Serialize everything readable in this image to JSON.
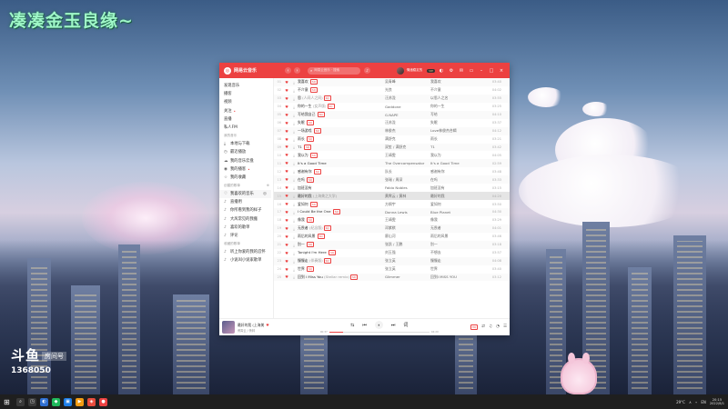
{
  "wallpaper": {
    "title": "凑凑金玉良缘~"
  },
  "douyu": {
    "logo": "斗鱼",
    "room_tag": "房间号",
    "room_number": "1368050"
  },
  "app": {
    "name": "网易云音乐",
    "search_placeholder": "网易云音乐 · 搜索",
    "user_name": "情绪稳定的",
    "vip_badge": "VIP"
  },
  "sidebar": {
    "items": [
      {
        "label": "发现音乐",
        "icon": ""
      },
      {
        "label": "播客",
        "icon": ""
      },
      {
        "label": "视频",
        "icon": ""
      },
      {
        "label": "关注",
        "icon": "",
        "dot": "•"
      },
      {
        "label": "直播",
        "icon": ""
      },
      {
        "label": "私人FM",
        "icon": ""
      }
    ],
    "my_music_title": "我的音乐",
    "my_music_items": [
      {
        "label": "本地与下载",
        "icon": "⤓"
      },
      {
        "label": "最近播放",
        "icon": "◷"
      },
      {
        "label": "我的音乐云盘",
        "icon": "☁"
      },
      {
        "label": "我的播客",
        "icon": "◉",
        "dot": "•"
      },
      {
        "label": "我的收藏",
        "icon": "☆"
      }
    ],
    "created_title": "创建的歌单",
    "created_add": "⊕",
    "created_items": [
      {
        "label": "我喜欢的音乐",
        "icon": "♡",
        "extra": "◎",
        "active": true
      },
      {
        "label": "直播用",
        "icon": "♪"
      },
      {
        "label": "你所看到我的样子",
        "icon": "♪"
      },
      {
        "label": "大风常见的我搬",
        "icon": "♪"
      },
      {
        "label": "喜欢的歌单",
        "icon": "♪"
      },
      {
        "label": "评论",
        "icon": "♪"
      }
    ],
    "fav_title": "收藏的歌单",
    "fav_items": [
      {
        "label": "听上你爱的我的忍怀",
        "icon": "♪"
      },
      {
        "label": "小说叫小说家歌单",
        "icon": "♪"
      }
    ]
  },
  "tracks": [
    {
      "idx": "01",
      "title": "我喜欢",
      "sub": "",
      "tag": "SQ",
      "artist": "吴青峰",
      "album": "我喜欢",
      "time": "03:40"
    },
    {
      "idx": "02",
      "title": "不介意",
      "sub": "",
      "tag": "SQ",
      "artist": "光良",
      "album": "不介意",
      "time": "04:02"
    },
    {
      "idx": "03",
      "title": "思",
      "sub": "(人间人之间)",
      "tag": "SQ",
      "artist": "汪苏泷",
      "album": "以思人之名",
      "time": "03:55"
    },
    {
      "idx": "04",
      "title": "你的一生",
      "sub": "(女声版)",
      "tag": "SQ",
      "artist": "Gaddone",
      "album": "你的一生",
      "time": "03:25"
    },
    {
      "idx": "05",
      "title": "写给我自己",
      "sub": "",
      "tag": "SQ",
      "artist": "G.NAPE",
      "album": "写给",
      "time": "04:10"
    },
    {
      "idx": "06",
      "title": "失眠",
      "sub": "",
      "tag": "SQ",
      "artist": "汪苏泷",
      "album": "失眠",
      "time": "03:37"
    },
    {
      "idx": "07",
      "title": "一场游戏",
      "sub": "",
      "tag": "SQ",
      "artist": "林俊杰",
      "album": "Love林俊杰合辑",
      "time": "04:12"
    },
    {
      "idx": "08",
      "title": "雨长",
      "sub": "",
      "tag": "SQ",
      "artist": "满舒克",
      "album": "雨长",
      "time": "03:21"
    },
    {
      "idx": "09",
      "title": "T1",
      "sub": "",
      "tag": "SQ",
      "artist": "双笙 / 满舒克",
      "album": "T1",
      "time": "03:42"
    },
    {
      "idx": "10",
      "title": "我以为",
      "sub": "",
      "tag": "SQ",
      "artist": "王靖雯",
      "album": "我以为",
      "time": "04:05"
    },
    {
      "idx": "11",
      "title": "It's a Good Time",
      "sub": "",
      "tag": "",
      "artist": "The Overcompensator",
      "album": "It's a Good Time",
      "time": "02:59"
    },
    {
      "idx": "12",
      "title": "感谢有你",
      "sub": "",
      "tag": "SQ",
      "artist": "队长",
      "album": "感谢有你",
      "time": "03:48"
    },
    {
      "idx": "13",
      "title": "在吗",
      "sub": "",
      "tag": "SQ",
      "artist": "张瑞 / 周深",
      "album": "在吗",
      "time": "03:33"
    },
    {
      "idx": "14",
      "title": "加班没有",
      "sub": "",
      "tag": "",
      "artist": "Fabio Nobles",
      "album": "加班没有",
      "time": "03:15"
    },
    {
      "idx": "15",
      "title": "最好的我",
      "sub": "(上海美之大学)",
      "tag": "",
      "artist": "黄霄云 / 黄林",
      "album": "最好的我",
      "time": "04:20",
      "playing": true
    },
    {
      "idx": "16",
      "title": "爱如何",
      "sub": "",
      "tag": "SQ",
      "artist": "方炯宇",
      "album": "爱如何",
      "time": "03:50"
    },
    {
      "idx": "17",
      "title": "I Could Be the One",
      "sub": "",
      "tag": "SQ",
      "artist": "Donna Lewis",
      "album": "Blue Planet",
      "time": "04:30"
    },
    {
      "idx": "18",
      "title": "像我",
      "sub": "",
      "tag": "SQ",
      "artist": "王靖雯",
      "album": "像我",
      "time": "03:29"
    },
    {
      "idx": "19",
      "title": "无畏者",
      "sub": "(纪念版)",
      "tag": "SQ",
      "artist": "邓紫棋",
      "album": "无畏者",
      "time": "04:01"
    },
    {
      "idx": "20",
      "title": "雨后的风景",
      "sub": "",
      "tag": "SQ",
      "artist": "廖山河",
      "album": "雨后的风景",
      "time": "03:46"
    },
    {
      "idx": "21",
      "title": "别一",
      "sub": "",
      "tag": "SQ",
      "artist": "张凯 / 王鹏",
      "album": "别一",
      "time": "03:18"
    },
    {
      "idx": "22",
      "title": "Tonight I'm Here",
      "sub": "",
      "tag": "SQ",
      "artist": "刘玉强",
      "album": "不想去",
      "time": "03:57"
    },
    {
      "idx": "23",
      "title": "慢慢走",
      "sub": "(伴奏版)",
      "tag": "SQ",
      "artist": "张立英",
      "album": "慢慢走",
      "time": "04:08"
    },
    {
      "idx": "24",
      "title": "世界",
      "sub": "",
      "tag": "SQ",
      "artist": "张立英",
      "album": "世界",
      "time": "03:40"
    },
    {
      "idx": "25",
      "title": "回到 I Miss You",
      "sub": "(Stellar remix)",
      "tag": "SQ",
      "artist": "Glimmer",
      "album": "回到I MISS YOU",
      "time": "03:12"
    }
  ],
  "player": {
    "now_title": "最好的我 (上海美",
    "now_artist": "黄霄云 / 黄林",
    "time_current": "00:37",
    "time_total": "04:20",
    "progress": 0.14,
    "hq_label": "HQ",
    "ctrl_icons": {
      "like": "♥",
      "mode": "⇆",
      "prev": "⏮",
      "play": "⏸",
      "next": "⏭",
      "lyric": "词"
    },
    "right_icons": [
      "⇄",
      "♫",
      "◔",
      "☰"
    ]
  },
  "taskbar": {
    "start_icon": "⊞",
    "apps": [
      {
        "icon": "⌕",
        "color": "#3a3a3a"
      },
      {
        "icon": "◳",
        "color": "#3a3a3a"
      },
      {
        "icon": "◐",
        "color": "#2f6fd1"
      },
      {
        "icon": "◆",
        "color": "#1fb95b"
      },
      {
        "icon": "▣",
        "color": "#1d7ee8"
      },
      {
        "icon": "▶",
        "color": "#f39c12"
      },
      {
        "icon": "◈",
        "color": "#e84c3d"
      },
      {
        "icon": "●",
        "color": "#ec4141"
      }
    ],
    "tray_temp": "29°C",
    "tray_icons": [
      "∧",
      "⌁",
      "EN"
    ],
    "clock_time": "20:15",
    "clock_date": "2022/8/1"
  }
}
